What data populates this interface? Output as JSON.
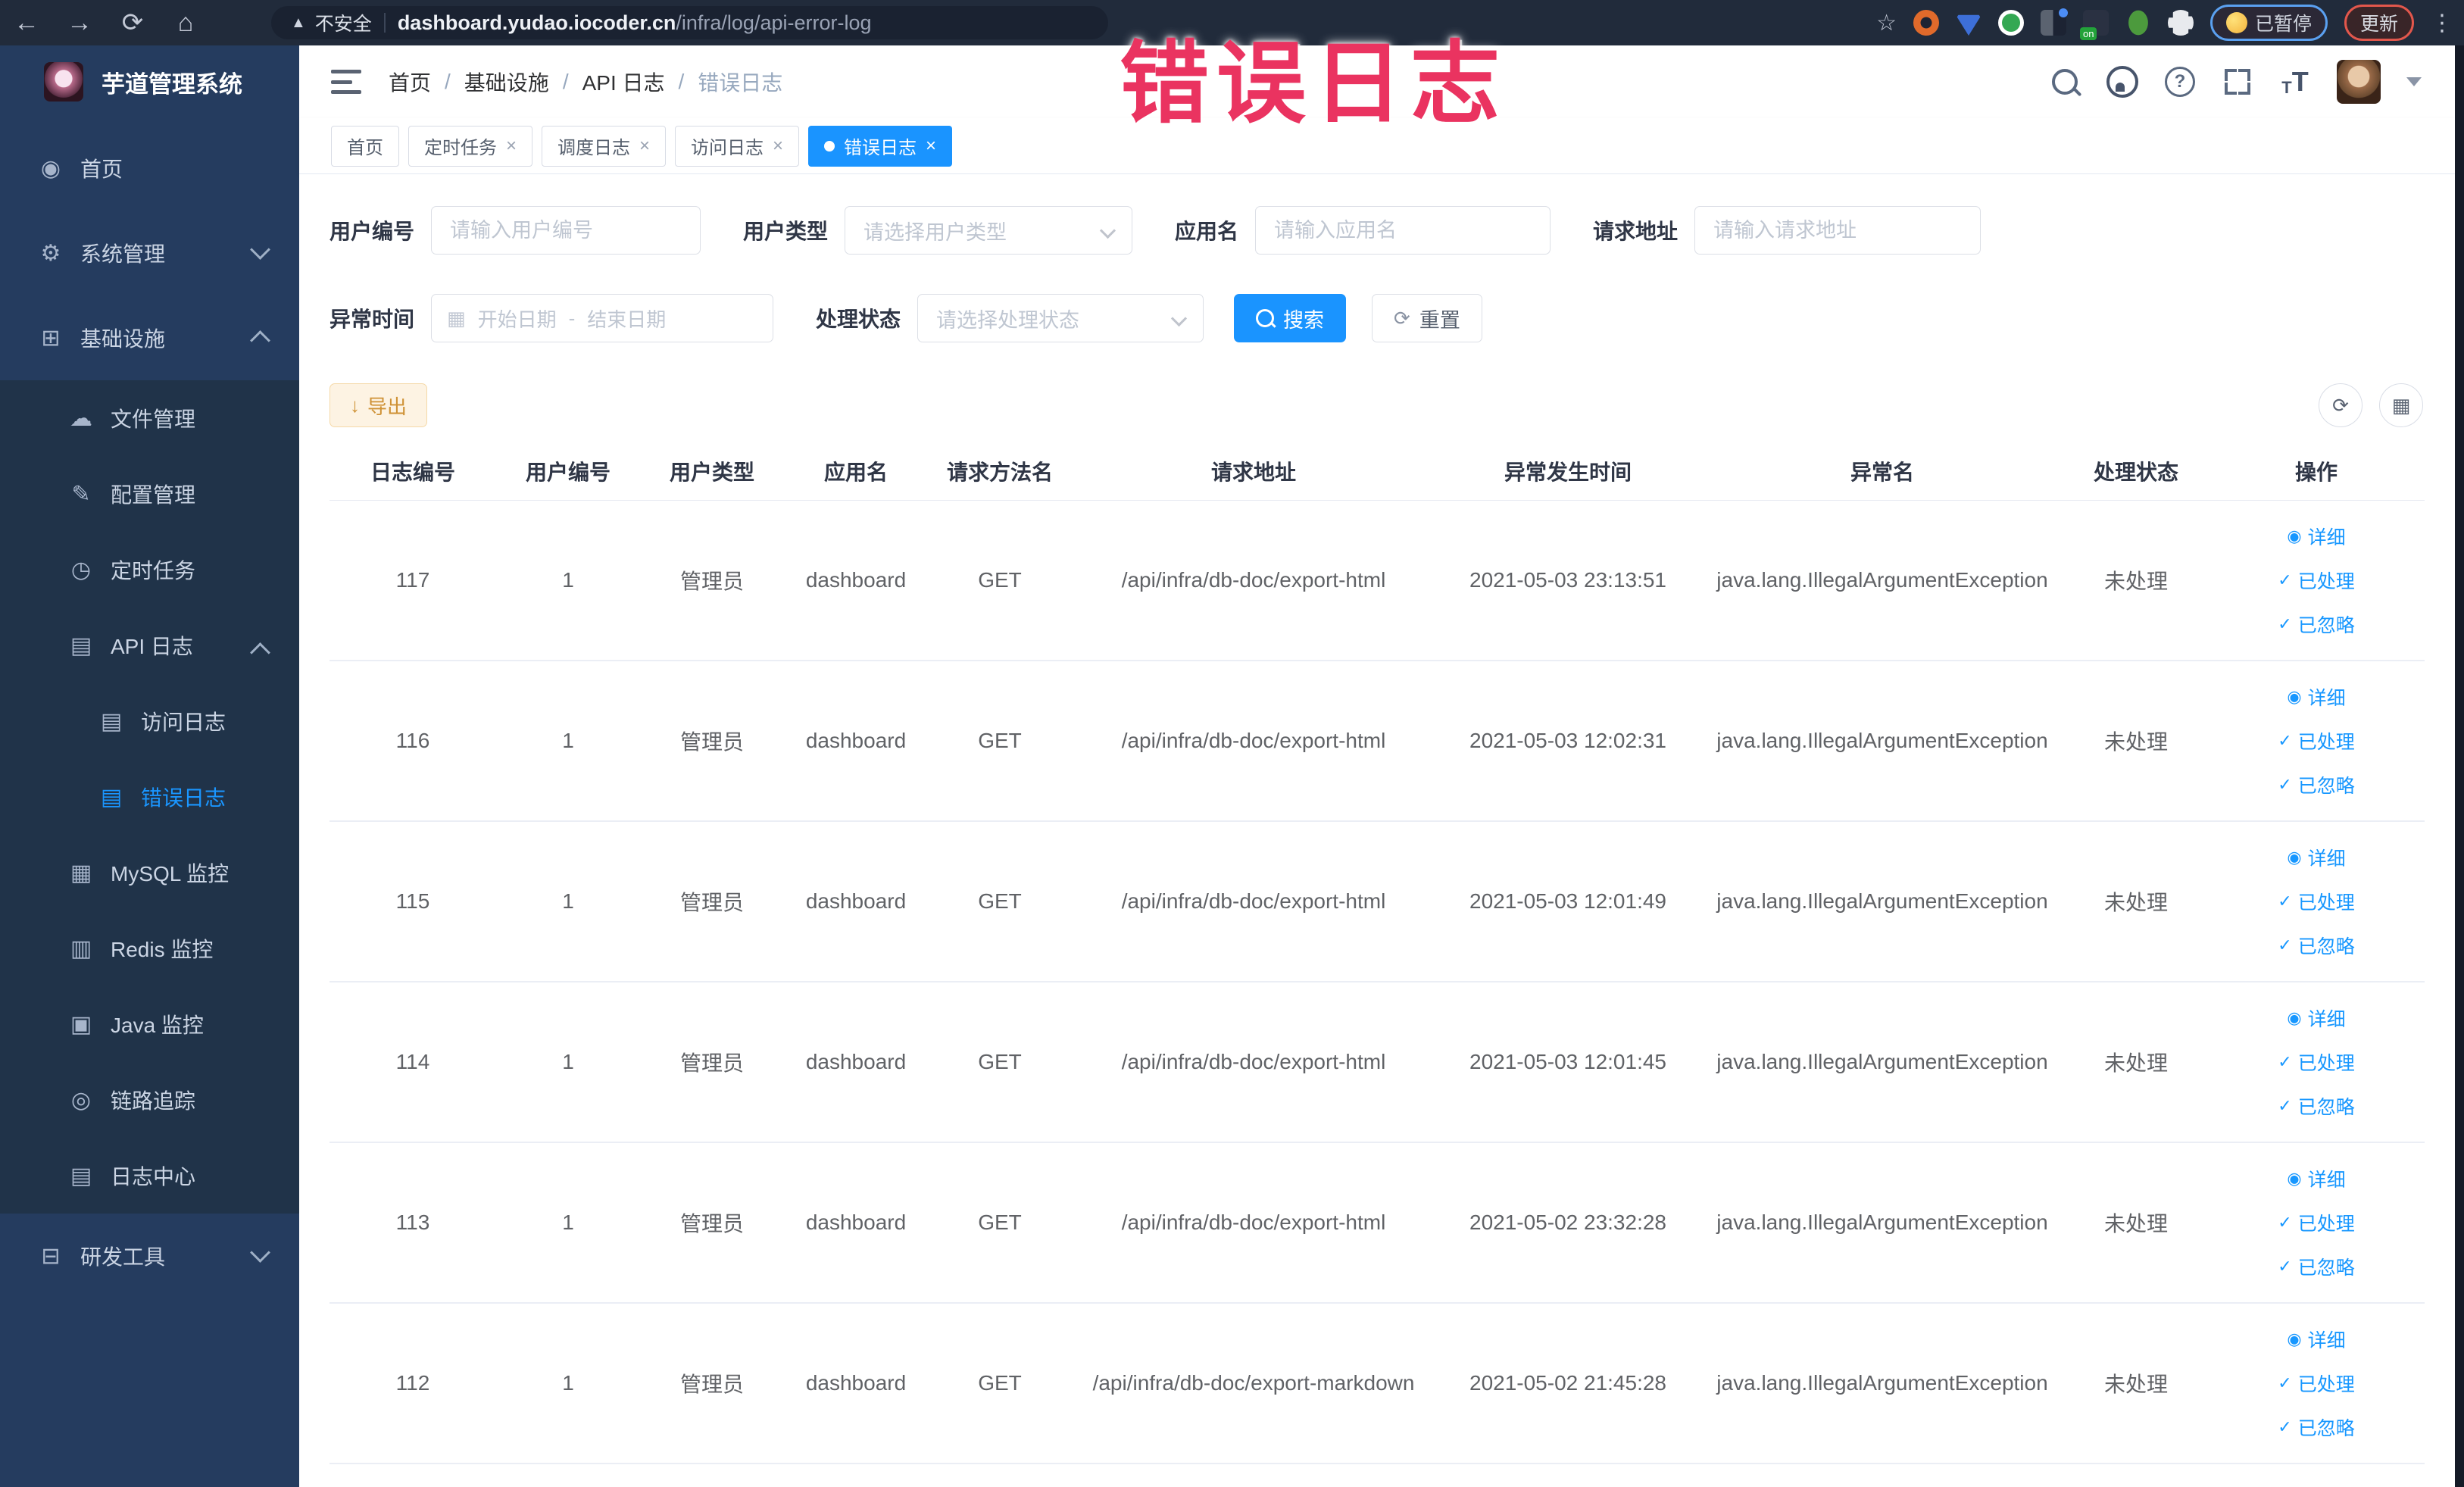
{
  "icons": {
    "back": "←",
    "forward": "→",
    "reload": "⟳",
    "home": "⌂",
    "warning": "▲",
    "star": "☆",
    "menu_dots": "⋮",
    "close": "×",
    "calendar": "▦",
    "download": "↓",
    "refresh": "⟳",
    "columns": "▦",
    "eye": "◉",
    "check": "✓",
    "help": "?",
    "fontsize": "T"
  },
  "browser": {
    "security_label": "不安全",
    "url_domain": "dashboard.yudao.iocoder.cn",
    "url_path": "/infra/log/api-error-log",
    "paused_badge": "已暂停",
    "update_button": "更新"
  },
  "annotation": {
    "text": "错误日志"
  },
  "sidebar": {
    "title": "芋道管理系统",
    "items": [
      {
        "label": "首页",
        "glyph": "◉"
      },
      {
        "label": "系统管理",
        "glyph": "⚙"
      },
      {
        "label": "基础设施",
        "glyph": "⊞"
      },
      {
        "label": "文件管理",
        "glyph": "☁"
      },
      {
        "label": "配置管理",
        "glyph": "✎"
      },
      {
        "label": "定时任务",
        "glyph": "◷"
      },
      {
        "label": "API 日志",
        "glyph": "▤"
      },
      {
        "label": "访问日志",
        "glyph": "▤"
      },
      {
        "label": "错误日志",
        "glyph": "▤"
      },
      {
        "label": "MySQL 监控",
        "glyph": "▦"
      },
      {
        "label": "Redis 监控",
        "glyph": "▥"
      },
      {
        "label": "Java 监控",
        "glyph": "▣"
      },
      {
        "label": "链路追踪",
        "glyph": "◎"
      },
      {
        "label": "日志中心",
        "glyph": "▤"
      },
      {
        "label": "研发工具",
        "glyph": "⊟"
      }
    ]
  },
  "breadcrumb": {
    "separator": "/",
    "items": [
      "首页",
      "基础设施",
      "API 日志",
      "错误日志"
    ]
  },
  "tabs": [
    {
      "label": "首页"
    },
    {
      "label": "定时任务"
    },
    {
      "label": "调度日志"
    },
    {
      "label": "访问日志"
    },
    {
      "label": "错误日志"
    }
  ],
  "filters": {
    "user_id": {
      "label": "用户编号",
      "placeholder": "请输入用户编号"
    },
    "user_type": {
      "label": "用户类型",
      "placeholder": "请选择用户类型"
    },
    "app_name": {
      "label": "应用名",
      "placeholder": "请输入应用名"
    },
    "request_url": {
      "label": "请求地址",
      "placeholder": "请输入请求地址"
    },
    "exception_time": {
      "label": "异常时间",
      "start_placeholder": "开始日期",
      "separator": "-",
      "end_placeholder": "结束日期"
    },
    "process_status": {
      "label": "处理状态",
      "placeholder": "请选择处理状态"
    },
    "search_label": "搜索",
    "reset_label": "重置"
  },
  "toolbar": {
    "export_label": "导出"
  },
  "table": {
    "headers": [
      "日志编号",
      "用户编号",
      "用户类型",
      "应用名",
      "请求方法名",
      "请求地址",
      "异常发生时间",
      "异常名",
      "处理状态",
      "操作"
    ],
    "action_labels": {
      "detail": "详细",
      "processed": "已处理",
      "ignored": "已忽略"
    },
    "rows": [
      {
        "id": "117",
        "user_id": "1",
        "user_type": "管理员",
        "app": "dashboard",
        "method": "GET",
        "url": "/api/infra/db-doc/export-html",
        "time": "2021-05-03 23:13:51",
        "exception": "java.lang.IllegalArgumentException",
        "status": "未处理"
      },
      {
        "id": "116",
        "user_id": "1",
        "user_type": "管理员",
        "app": "dashboard",
        "method": "GET",
        "url": "/api/infra/db-doc/export-html",
        "time": "2021-05-03 12:02:31",
        "exception": "java.lang.IllegalArgumentException",
        "status": "未处理"
      },
      {
        "id": "115",
        "user_id": "1",
        "user_type": "管理员",
        "app": "dashboard",
        "method": "GET",
        "url": "/api/infra/db-doc/export-html",
        "time": "2021-05-03 12:01:49",
        "exception": "java.lang.IllegalArgumentException",
        "status": "未处理"
      },
      {
        "id": "114",
        "user_id": "1",
        "user_type": "管理员",
        "app": "dashboard",
        "method": "GET",
        "url": "/api/infra/db-doc/export-html",
        "time": "2021-05-03 12:01:45",
        "exception": "java.lang.IllegalArgumentException",
        "status": "未处理"
      },
      {
        "id": "113",
        "user_id": "1",
        "user_type": "管理员",
        "app": "dashboard",
        "method": "GET",
        "url": "/api/infra/db-doc/export-html",
        "time": "2021-05-02 23:32:28",
        "exception": "java.lang.IllegalArgumentException",
        "status": "未处理"
      },
      {
        "id": "112",
        "user_id": "1",
        "user_type": "管理员",
        "app": "dashboard",
        "method": "GET",
        "url": "/api/infra/db-doc/export-markdown",
        "time": "2021-05-02 21:45:28",
        "exception": "java.lang.IllegalArgumentException",
        "status": "未处理"
      }
    ]
  }
}
